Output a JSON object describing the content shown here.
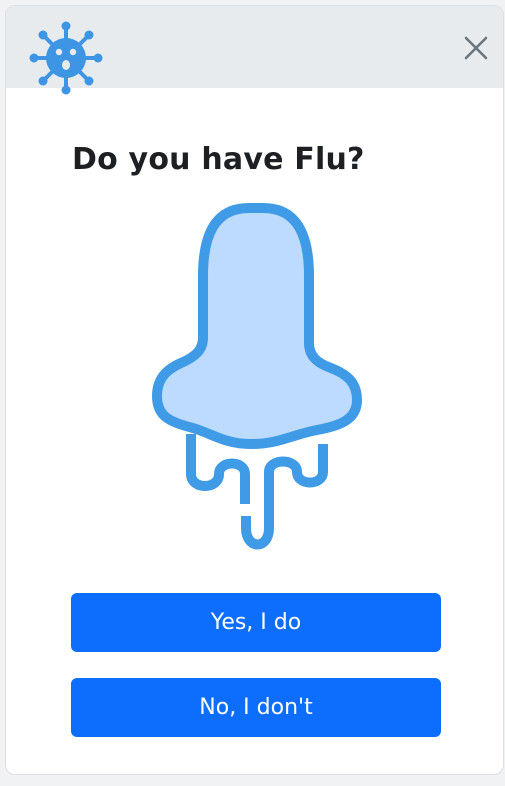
{
  "dialog": {
    "title": "Do you have Flu?",
    "buttons": {
      "yes_label": "Yes, I do",
      "no_label": "No, I don't"
    }
  },
  "icons": {
    "logo": "virus-icon",
    "close": "close-icon",
    "illustration": "runny-nose-icon"
  },
  "colors": {
    "header_bg": "#e8ebee",
    "logo_blue": "#3d95e4",
    "illustration_stroke": "#3f9be6",
    "illustration_fill": "#bddbff",
    "button_bg": "#0d6efd",
    "button_text": "#ffffff",
    "title_text": "#1d1f22",
    "close_icon": "#6c757d"
  }
}
